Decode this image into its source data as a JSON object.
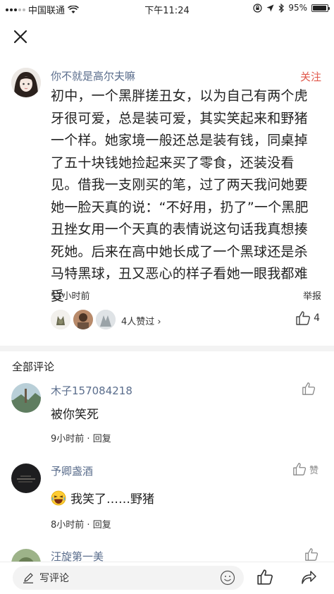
{
  "status_bar": {
    "carrier": "中国联通",
    "time": "下午11:24",
    "battery": "95%",
    "battery_level": 0.95
  },
  "post": {
    "author": "你不就是高尔夫嘛",
    "follow_label": "关注",
    "lines": [
      "初中，一个黑胖搓丑女，以为自己有两个虎",
      "牙很可爱，总是装可爱，其实笑起来和野猪",
      "一个样。她家境一般还总是装有钱，同桌掉",
      "了五十块钱她捡起来买了零食，还装没看",
      "见。借我一支刚买的笔，过了两天我问她要",
      "她一脸天真的说：“不好用，扔了”一个黑肥",
      "丑挫女用一个天真的表情说这句话我真想揍",
      "死她。后来在高中她长成了一个黑球还是杀",
      "马特黑球，丑又恶心的样子看她一眼我都难",
      "受"
    ],
    "time": "11小时前",
    "report_label": "举报",
    "likers_text": "4人赞过 ›",
    "like_count": "4"
  },
  "comments_section": {
    "title": "全部评论",
    "comments": [
      {
        "name": "木子157084218",
        "text": "被你笑死",
        "time": "9小时前",
        "reply": "回复",
        "like_label": ""
      },
      {
        "name": "予卿盏酒",
        "text": "我笑了……野猪",
        "time": "8小时前",
        "reply": "回复",
        "like_label": "赞"
      },
      {
        "name": "汪旋第一美",
        "text": "",
        "time": "",
        "reply": "",
        "like_label": ""
      }
    ]
  },
  "bottom_bar": {
    "write_placeholder": "写评论"
  },
  "colors": {
    "author_link": "#5a6d8c",
    "follow": "#e0584b",
    "divider": "#f3f3f3"
  }
}
